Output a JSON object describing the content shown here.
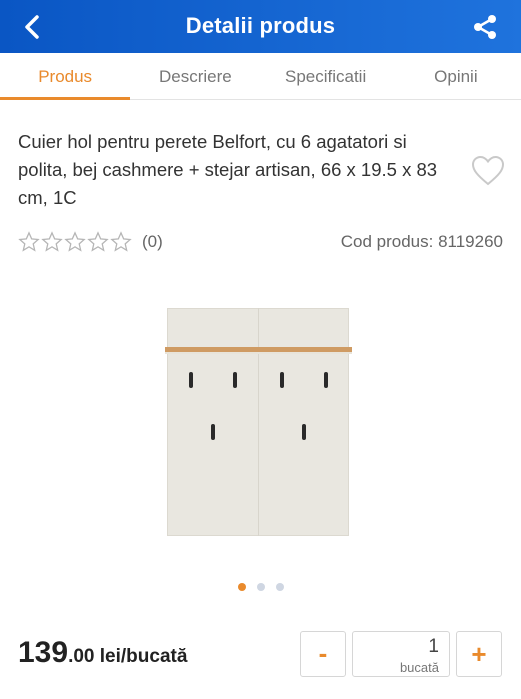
{
  "header": {
    "title": "Detalii produs",
    "back_icon": "chevron-left-icon",
    "share_icon": "share-icon"
  },
  "tabs": [
    {
      "label": "Produs",
      "active": true
    },
    {
      "label": "Descriere",
      "active": false
    },
    {
      "label": "Specificatii",
      "active": false
    },
    {
      "label": "Opinii",
      "active": false
    }
  ],
  "product": {
    "title": "Cuier hol pentru perete Belfort, cu 6 agatatori si polita, bej cashmere + stejar artisan, 66 x 19.5 x 83 cm, 1C",
    "favorite_icon": "heart-icon",
    "rating": 0,
    "review_count": "(0)",
    "code": "Cod produs: 8119260"
  },
  "gallery": {
    "image_count": 3,
    "active_index": 0
  },
  "price": {
    "integer": "139",
    "decimal": ".00",
    "unit": " lei/bucată"
  },
  "quantity": {
    "minus_label": "-",
    "value": "1",
    "unit": "bucată",
    "plus_label": "+"
  },
  "colors": {
    "header": "#1565d8",
    "accent": "#e98a2c"
  }
}
